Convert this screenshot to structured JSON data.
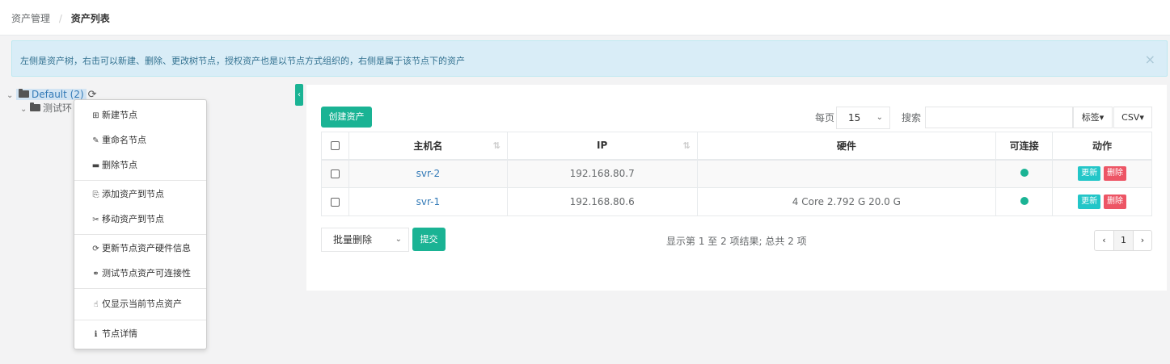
{
  "breadcrumb": {
    "parent": "资产管理",
    "separator": "/",
    "current": "资产列表"
  },
  "alert": {
    "text": "左侧是资产树，右击可以新建、删除、更改树节点，授权资产也是以节点方式组织的，右侧是属于该节点下的资产",
    "close": "×"
  },
  "tree": {
    "root_label": "Default (2)",
    "child_label": "测试环"
  },
  "context_menu": {
    "items": [
      {
        "icon": "⊞",
        "label": "新建节点"
      },
      {
        "icon": "✎",
        "label": "重命名节点"
      },
      {
        "icon": "▬",
        "label": "删除节点"
      },
      {
        "icon": "⎘",
        "label": "添加资产到节点"
      },
      {
        "icon": "✂",
        "label": "移动资产到节点"
      },
      {
        "icon": "⟳",
        "label": "更新节点资产硬件信息"
      },
      {
        "icon": "⚭",
        "label": "测试节点资产可连接性"
      },
      {
        "icon": "☝",
        "label": "仅显示当前节点资产"
      },
      {
        "icon": "ℹ",
        "label": "节点详情"
      }
    ]
  },
  "toolbar": {
    "create_label": "创建资产",
    "per_page_label": "每页",
    "per_page_value": "15",
    "search_label": "搜索",
    "search_value": "",
    "tags_label": "标签▾",
    "csv_label": "CSV▾"
  },
  "table": {
    "columns": [
      "主机名",
      "IP",
      "硬件",
      "可连接",
      "动作"
    ],
    "rows": [
      {
        "hostname": "svr-2",
        "ip": "192.168.80.7",
        "hardware": "",
        "connectable": true,
        "update": "更新",
        "delete": "删除"
      },
      {
        "hostname": "svr-1",
        "ip": "192.168.80.6",
        "hardware": "4 Core 2.792 G 20.0 G",
        "connectable": true,
        "update": "更新",
        "delete": "删除"
      }
    ]
  },
  "footer": {
    "bulk_action": "批量删除",
    "submit_label": "提交",
    "summary": "显示第 1 至 2 项结果; 总共 2 项",
    "pager": {
      "prev": "‹",
      "current": "1",
      "next": "›"
    }
  },
  "colors": {
    "accent": "#1ab394",
    "info": "#23c6c8",
    "danger": "#ed5565",
    "link": "#337ab7"
  }
}
